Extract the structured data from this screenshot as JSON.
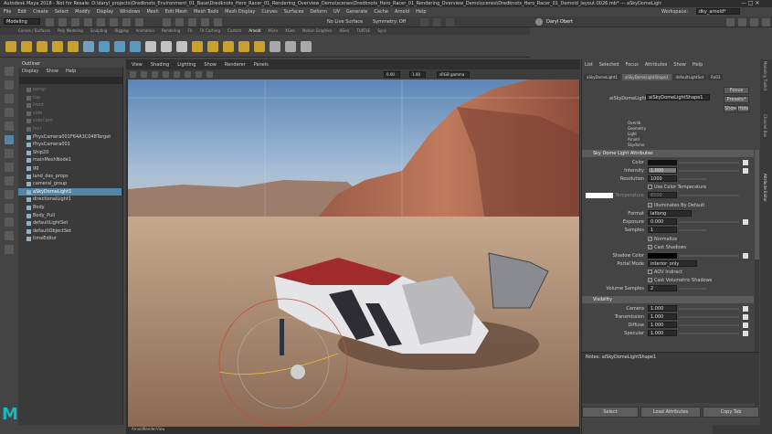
{
  "window": {
    "title": "Autodesk Maya 2018 - Not for Resale: D:\\daryl_projects\\Dredknots_Environment_01_Base\\Dredknots_Hero_Racer_01_Rendering_Overview_Demo\\scenes\\Dredknots_Hero_Racer_01_Rendering_Overview_Demo\\scenes\\Dredknots_Hero_Racer_01_Demoid_layout.0026.mb* --- aSkyDomeLight1"
  },
  "menubar": [
    "File",
    "Edit",
    "Create",
    "Select",
    "Modify",
    "Display",
    "Windows",
    "Mesh",
    "Edit Mesh",
    "Mesh Tools",
    "Mesh Display",
    "Curves",
    "Surfaces",
    "Deform",
    "UV",
    "Generate",
    "Cache",
    "Arnold",
    "Help"
  ],
  "workspace": {
    "label": "Workspace:",
    "value": "dky_arnold*"
  },
  "status": {
    "menuset": "Modeling",
    "live": "No Live Surface",
    "symmetry": "Symmetry: Off",
    "user": "Daryl Obert"
  },
  "shelf_tabs": [
    "Curves / Surfaces",
    "Poly Modeling",
    "Sculpting",
    "Rigging",
    "Animation",
    "Rendering",
    "FX",
    "FX Caching",
    "Custom",
    "Arnold",
    "XGen",
    "XGen",
    "Motion Graphics",
    "XGen",
    "TURTLE",
    "Sync"
  ],
  "outliner": {
    "title": "Outliner",
    "menu": [
      "Display",
      "Show",
      "Help"
    ],
    "items": [
      "persp",
      "top",
      "front",
      "side",
      "sideCam",
      "faci",
      "PhysCamera001F64A3C048Target",
      "PhysCamera001",
      "Ship20",
      "mainMeshNode1",
      "gg",
      "land_des_props",
      "cameral_group",
      "aSkyDomeLight1",
      "directionalLight1",
      "Body",
      "Body_Pull",
      "defaultLightSet",
      "defaultObjectSet",
      "timeEditor"
    ]
  },
  "viewport": {
    "menu": [
      "View",
      "Shading",
      "Lighting",
      "Show",
      "Renderer",
      "Panels"
    ],
    "v1": "0.00",
    "v2": "1.00",
    "colorspace": "sRGB gamma",
    "camlabel": "AmoldRenderView"
  },
  "ae": {
    "menu": [
      "List",
      "Selected",
      "Focus",
      "Attributes",
      "Show",
      "Help"
    ],
    "tabs": [
      "aSkyDomeLight1",
      "aiSkyDomeLightShape1",
      "defaultLightSet",
      "Ra03"
    ],
    "node_label": "aiSkyDomeLight:",
    "node_value": "aiSkyDomeLightShape1",
    "focus": "Focus",
    "presets": "Presets*",
    "show": "Show",
    "hide": "Hide",
    "sections": [
      "Sky Dome Light Attributes",
      "Visibility"
    ],
    "fields": {
      "color": "Color",
      "intensity": "Intensity",
      "intensity_val": "1.000",
      "resolution": "Resolution",
      "resolution_val": "1000",
      "use_temp": "Use Color Temperature",
      "temperature": "Temperature",
      "temperature_val": "6500",
      "illuminates": "Illuminates By Default",
      "format": "Format",
      "format_val": "latlong",
      "exposure": "Exposure",
      "exposure_val": "0.000",
      "samples": "Samples",
      "samples_val": "1",
      "normalize": "Normalize",
      "cast_shadows": "Cast Shadows",
      "shadow_color": "Shadow Color",
      "portal_mode": "Portal Mode",
      "portal_val": "interior_only",
      "aov": "AOV Indirect",
      "cast_vol": "Cast Volumetric Shadows",
      "vol_samples": "Volume Samples",
      "vol_samples_val": "2",
      "camera": "Camera",
      "camera_val": "1.000",
      "transmission": "Transmission",
      "transmission_val": "1.000",
      "diffuse": "Diffuse",
      "diffuse_val": "1.000",
      "specular": "Specular",
      "specular_val": "1.000"
    },
    "notes": "Notes: aiSkyDomeLightShape1",
    "bottom": [
      "Select",
      "Load Attributes",
      "Copy Tab"
    ],
    "labels": [
      "Overlib",
      "Geometry",
      "Light",
      "Arnold",
      "Skydome"
    ]
  },
  "side_tabs": [
    "Attribute Editor",
    "Channel Box",
    "Modeling Toolkit"
  ],
  "colors": {
    "accent": "#5285a6",
    "bg": "#444444"
  }
}
